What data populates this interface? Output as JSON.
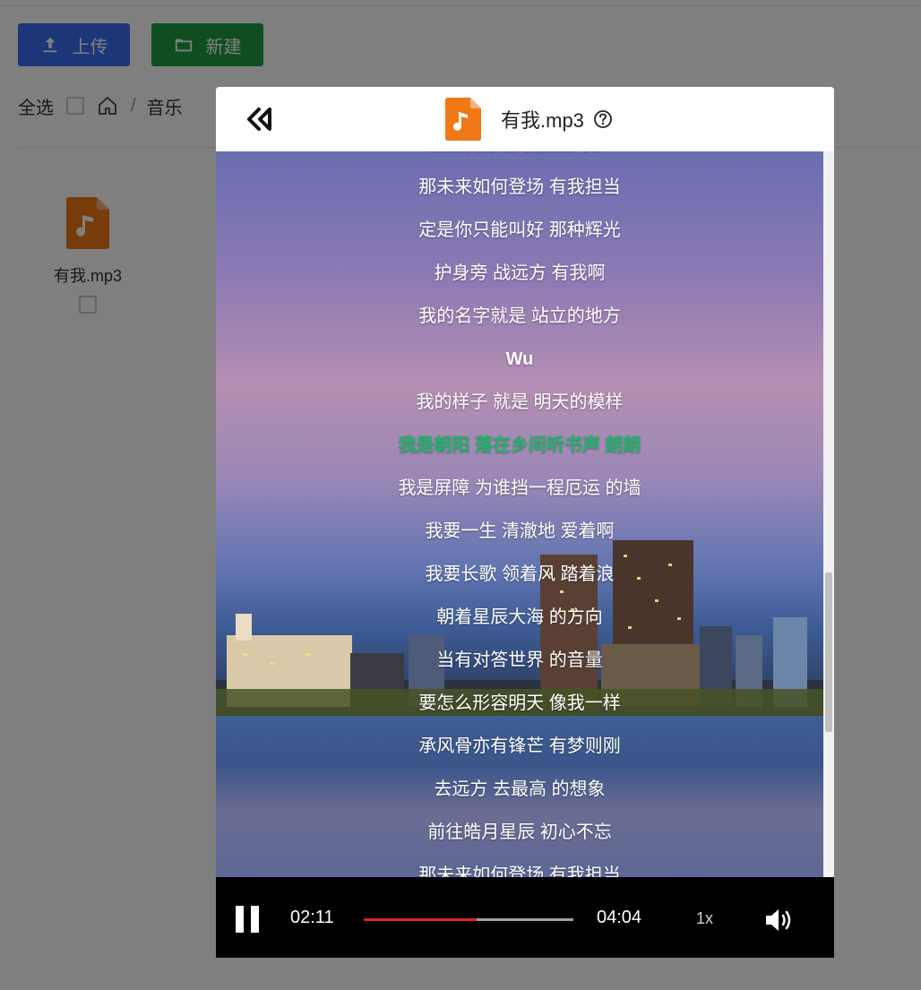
{
  "toolbar": {
    "upload_label": "上传",
    "new_label": "新建"
  },
  "breadcrumb": {
    "select_all_label": "全选",
    "folder": "音乐"
  },
  "files": [
    {
      "name": "有我.mp3",
      "icon": "music-file-icon"
    }
  ],
  "player": {
    "title": "有我.mp3",
    "accent": "#1fb36a",
    "lyrics": [
      "就在我身边 我把它守护",
      "那未来如何登场 有我担当",
      "定是你只能叫好 那种辉光",
      "护身旁 战远方 有我啊",
      "我的名字就是 站立的地方",
      "Wu",
      "我的样子 就是 明天的模样",
      "我是朝阳 落在乡间听书声 朗朗",
      "我是屏障 为谁挡一程厄运 的墙",
      "我要一生 清澈地 爱着啊",
      "我要长歌 领着风 踏着浪",
      "朝着星辰大海 的方向",
      "当有对答世界 的音量",
      "要怎么形容明天 像我一样",
      "承风骨亦有锋芒 有梦则刚",
      "去远方 去最高 的想象",
      "前往皓月星辰 初心不忘",
      "那未来如何登场 有我担当"
    ],
    "active_index": 7,
    "current_time": "02:11",
    "total_time": "04:04",
    "progress": 0.537,
    "speed": "1x"
  }
}
